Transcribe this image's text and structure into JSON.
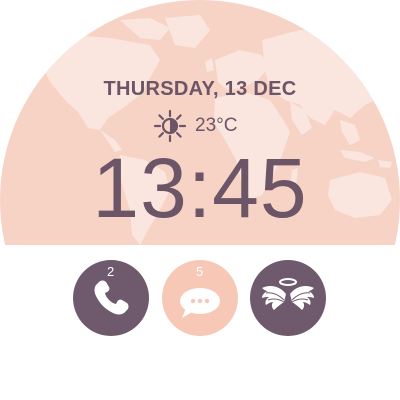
{
  "watch": {
    "date": "THURSDAY, 13 DEC",
    "temperature": "23°C",
    "time": "13:45"
  },
  "weather": {
    "icon": "sun-icon"
  },
  "shortcuts": [
    {
      "name": "phone",
      "icon": "phone-icon",
      "badge": "2"
    },
    {
      "name": "messages",
      "icon": "chat-icon",
      "badge": "5"
    },
    {
      "name": "wings",
      "icon": "angel-wings-icon"
    }
  ],
  "colors": {
    "top_background": "#f7d3c6",
    "map_land": "#fae6de",
    "text": "#6c5566",
    "button_dark": "#6f5a6d",
    "button_light": "#f7c8b6",
    "bottom_background": "#ffffff"
  }
}
